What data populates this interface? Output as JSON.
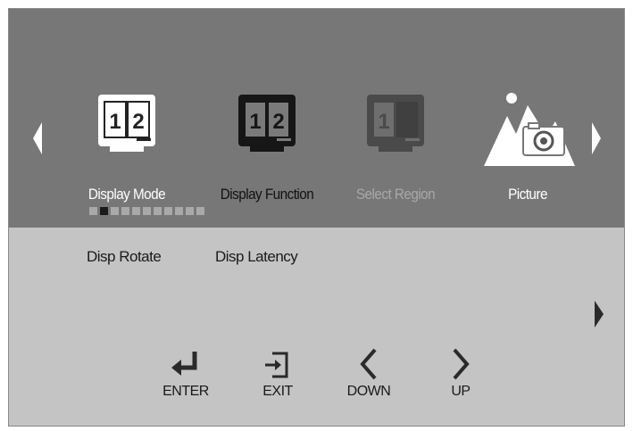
{
  "menu": {
    "items": [
      {
        "label": "Display Mode",
        "icon": "split-screen-12-icon",
        "state": "normal"
      },
      {
        "label": "Display Function",
        "icon": "split-screen-12-icon",
        "state": "selected"
      },
      {
        "label": "Select Region",
        "icon": "select-region-icon",
        "state": "disabled"
      },
      {
        "label": "Picture",
        "icon": "picture-icon",
        "state": "normal"
      }
    ],
    "page_count": 11,
    "active_page": 2
  },
  "submenu": {
    "items": [
      "Disp Rotate",
      "Disp Latency"
    ]
  },
  "nav": {
    "enter": "ENTER",
    "exit": "EXIT",
    "down": "DOWN",
    "up": "UP"
  },
  "icon_digits": {
    "one": "1",
    "two": "2"
  },
  "colors": {
    "top_panel": "#777777",
    "bottom_panel": "#c4c4c4",
    "label_normal": "#ffffff",
    "label_selected": "#111111",
    "label_disabled": "#a8a8a8"
  }
}
